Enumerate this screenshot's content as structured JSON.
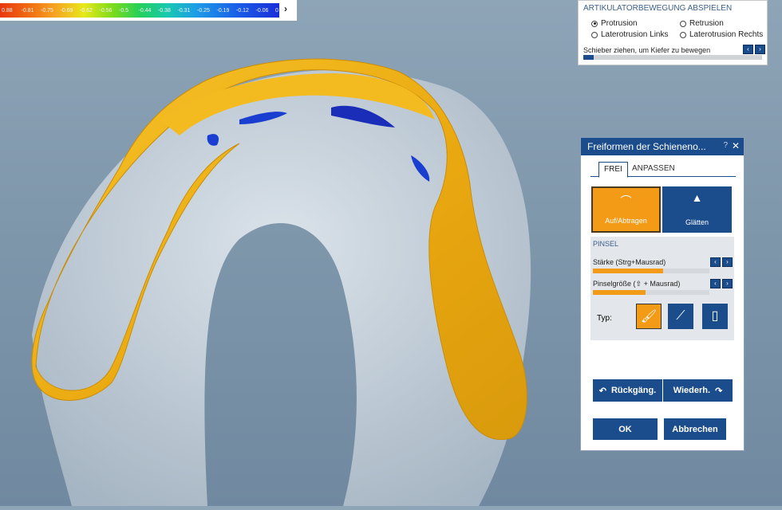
{
  "scale": {
    "ticks": [
      "0.88",
      "-0.81",
      "-0.75",
      "-0.69",
      "-0.62",
      "-0.56",
      "-0.5",
      "-0.44",
      "-0.38",
      "-0.31",
      "-0.25",
      "-0.19",
      "-0.12",
      "-0.06",
      "0"
    ],
    "expand_arrow": "›"
  },
  "articulator": {
    "title": "ARTIKULATORBEWEGUNG ABSPIELEN",
    "options": [
      {
        "label": "Protrusion",
        "selected": true
      },
      {
        "label": "Retrusion",
        "selected": false
      },
      {
        "label": "Laterotrusion Links",
        "selected": false
      },
      {
        "label": "Laterotrusion Rechts",
        "selected": false
      }
    ],
    "hint": "Schieber ziehen, um Kiefer zu bewegen",
    "progress": 0.06
  },
  "panel": {
    "title": "Freiformen der Schieneno...",
    "help": "?",
    "close": "✕",
    "tabs": [
      "FREI",
      "ANPASSEN"
    ],
    "tools": {
      "auf": "Auf/Abtragen",
      "glatt": "Glätten"
    },
    "pinsel": {
      "title": "PINSEL",
      "staerke_label": "Stärke (Strg+Mausrad)",
      "staerke_value": 0.6,
      "groesse_label": "Pinselgröße (⇧ + Mausrad)",
      "groesse_value": 0.45,
      "typ_label": "Typ:"
    },
    "undo": "Rückgäng.",
    "redo": "Wiederh.",
    "ok": "OK",
    "cancel": "Abbrechen"
  },
  "colors": {
    "accent_blue": "#1b4c8c",
    "accent_orange": "#f39a16",
    "splint": "#f0b21a",
    "jaw": "#b9c7d4"
  }
}
